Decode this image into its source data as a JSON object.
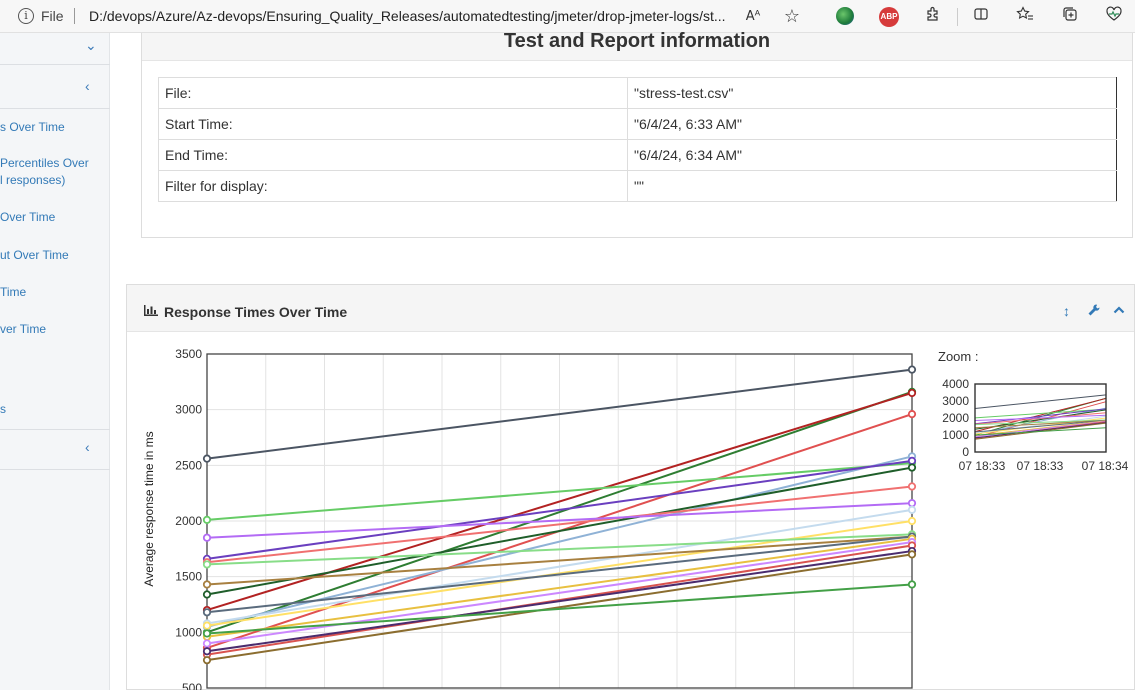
{
  "browser": {
    "file_label": "File",
    "url": "D:/devops/Azure/Az-devops/Ensuring_Quality_Releases/automatedtesting/jmeter/drop-jmeter-logs/st...",
    "read_aloud": "Aᴬ",
    "star": "☆"
  },
  "sidebar": {
    "items": [
      {
        "label": "s Over Time"
      },
      {
        "label": "Percentiles Over"
      },
      {
        "label": "l responses)"
      },
      {
        "label": "Over Time"
      },
      {
        "label": "ut Over Time"
      },
      {
        "label": "Time"
      },
      {
        "label": "ver Time"
      },
      {
        "label": "s"
      }
    ]
  },
  "report": {
    "title": "Test and Report information",
    "rows": [
      {
        "key": "File:",
        "value": "\"stress-test.csv\""
      },
      {
        "key": "Start Time:",
        "value": "\"6/4/24, 6:33 AM\""
      },
      {
        "key": "End Time:",
        "value": "\"6/4/24, 6:34 AM\""
      },
      {
        "key": "Filter for display:",
        "value": "\"\""
      }
    ]
  },
  "chart_panel": {
    "title": "Response Times Over Time",
    "zoom_label": "Zoom :"
  },
  "chart_data": [
    {
      "type": "line",
      "ylabel": "Average response time in ms",
      "ylim": [
        500,
        3500
      ],
      "yticks": [
        500,
        1000,
        1500,
        2000,
        2500,
        3000,
        3500
      ],
      "x": [
        0,
        1
      ],
      "grid": true,
      "series": [
        {
          "color": "#4b5563",
          "values": [
            2560,
            3360
          ]
        },
        {
          "color": "#2e7d32",
          "values": [
            1000,
            3160
          ]
        },
        {
          "color": "#b22222",
          "values": [
            1200,
            3150
          ]
        },
        {
          "color": "#e05050",
          "values": [
            860,
            2960
          ]
        },
        {
          "color": "#66cc66",
          "values": [
            2010,
            2520
          ]
        },
        {
          "color": "#8fb2d6",
          "values": [
            1050,
            2580
          ]
        },
        {
          "color": "#6a3fbf",
          "values": [
            1660,
            2540
          ]
        },
        {
          "color": "#1f5e2a",
          "values": [
            1340,
            2480
          ]
        },
        {
          "color": "#f07070",
          "values": [
            1630,
            2310
          ]
        },
        {
          "color": "#b36bf5",
          "values": [
            1850,
            2160
          ]
        },
        {
          "color": "#c4dbee",
          "values": [
            1080,
            2100
          ]
        },
        {
          "color": "#ffe066",
          "values": [
            1060,
            2000
          ]
        },
        {
          "color": "#88dd88",
          "values": [
            1610,
            1880
          ]
        },
        {
          "color": "#a88040",
          "values": [
            1430,
            1860
          ]
        },
        {
          "color": "#5a6b7d",
          "values": [
            1180,
            1860
          ]
        },
        {
          "color": "#e8c040",
          "values": [
            960,
            1840
          ]
        },
        {
          "color": "#cc88ff",
          "values": [
            900,
            1810
          ]
        },
        {
          "color": "#d9534f",
          "values": [
            800,
            1780
          ]
        },
        {
          "color": "#4a2c6e",
          "values": [
            830,
            1730
          ]
        },
        {
          "color": "#8b6d2f",
          "values": [
            750,
            1700
          ]
        },
        {
          "color": "#43a047",
          "values": [
            990,
            1430
          ]
        }
      ]
    },
    {
      "type": "line",
      "title": "",
      "ylim": [
        0,
        4000
      ],
      "yticks": [
        0,
        1000,
        2000,
        3000,
        4000
      ],
      "xtick_labels": [
        "07 18:33",
        "07 18:33",
        "07 18:34"
      ],
      "grid": false
    }
  ]
}
